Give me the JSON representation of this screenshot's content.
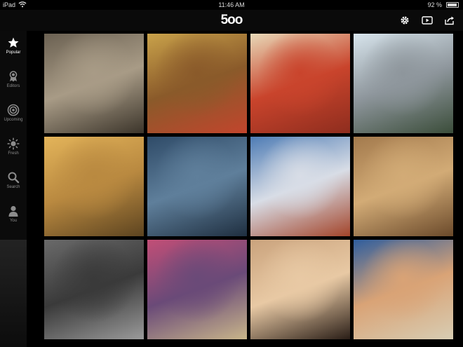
{
  "status_bar": {
    "carrier": "iPad",
    "time": "11:46 AM",
    "battery": "92 %",
    "battery_level": 0.92
  },
  "nav": {
    "logo": "5oo",
    "icons": [
      "gear-icon",
      "slideshow-icon",
      "share-icon"
    ]
  },
  "sidebar": {
    "items": [
      {
        "label": "Popular",
        "icon": "star-icon",
        "active": true
      },
      {
        "label": "Editors",
        "icon": "ribbon-icon",
        "active": false
      },
      {
        "label": "Upcoming",
        "icon": "target-icon",
        "active": false
      },
      {
        "label": "Fresh",
        "icon": "sun-icon",
        "active": false
      },
      {
        "label": "Search",
        "icon": "search-icon",
        "active": false
      },
      {
        "label": "You",
        "icon": "person-icon",
        "active": false
      }
    ]
  },
  "photos": [
    {
      "subject": "cat face closeup",
      "colors": [
        "#6b6152",
        "#a89b86",
        "#3c352b"
      ]
    },
    {
      "subject": "woman in red dress in grass",
      "colors": [
        "#c9a24a",
        "#8a5a2a",
        "#c2452d"
      ]
    },
    {
      "subject": "cat under red blanket",
      "colors": [
        "#e8d9b8",
        "#c9442c",
        "#8e2d1e"
      ]
    },
    {
      "subject": "silver car",
      "colors": [
        "#d7e4ec",
        "#8e969c",
        "#3b4d3a"
      ]
    },
    {
      "subject": "paraglider over dunes",
      "colors": [
        "#e3b45a",
        "#b98940",
        "#5d4420"
      ]
    },
    {
      "subject": "mountain lake with sheep",
      "colors": [
        "#2f4b68",
        "#5f7f9b",
        "#1f2f40"
      ]
    },
    {
      "subject": "red tower on snowy hill",
      "colors": [
        "#4e7cb5",
        "#d8dde6",
        "#a3442a"
      ]
    },
    {
      "subject": "lion roaring",
      "colors": [
        "#a37a4d",
        "#d2ab76",
        "#6b4a2b"
      ]
    },
    {
      "subject": "black and white woman portrait",
      "colors": [
        "#6a6a6a",
        "#3a3a3a",
        "#9a9a9a"
      ]
    },
    {
      "subject": "pink sky over lake",
      "colors": [
        "#c24e77",
        "#6a4a78",
        "#c8b58a"
      ]
    },
    {
      "subject": "woman face portrait",
      "colors": [
        "#caa37d",
        "#e8c9a4",
        "#2a1e17"
      ]
    },
    {
      "subject": "tropical beach sunset",
      "colors": [
        "#2f5e9e",
        "#d9a376",
        "#d8cdb3"
      ]
    }
  ]
}
